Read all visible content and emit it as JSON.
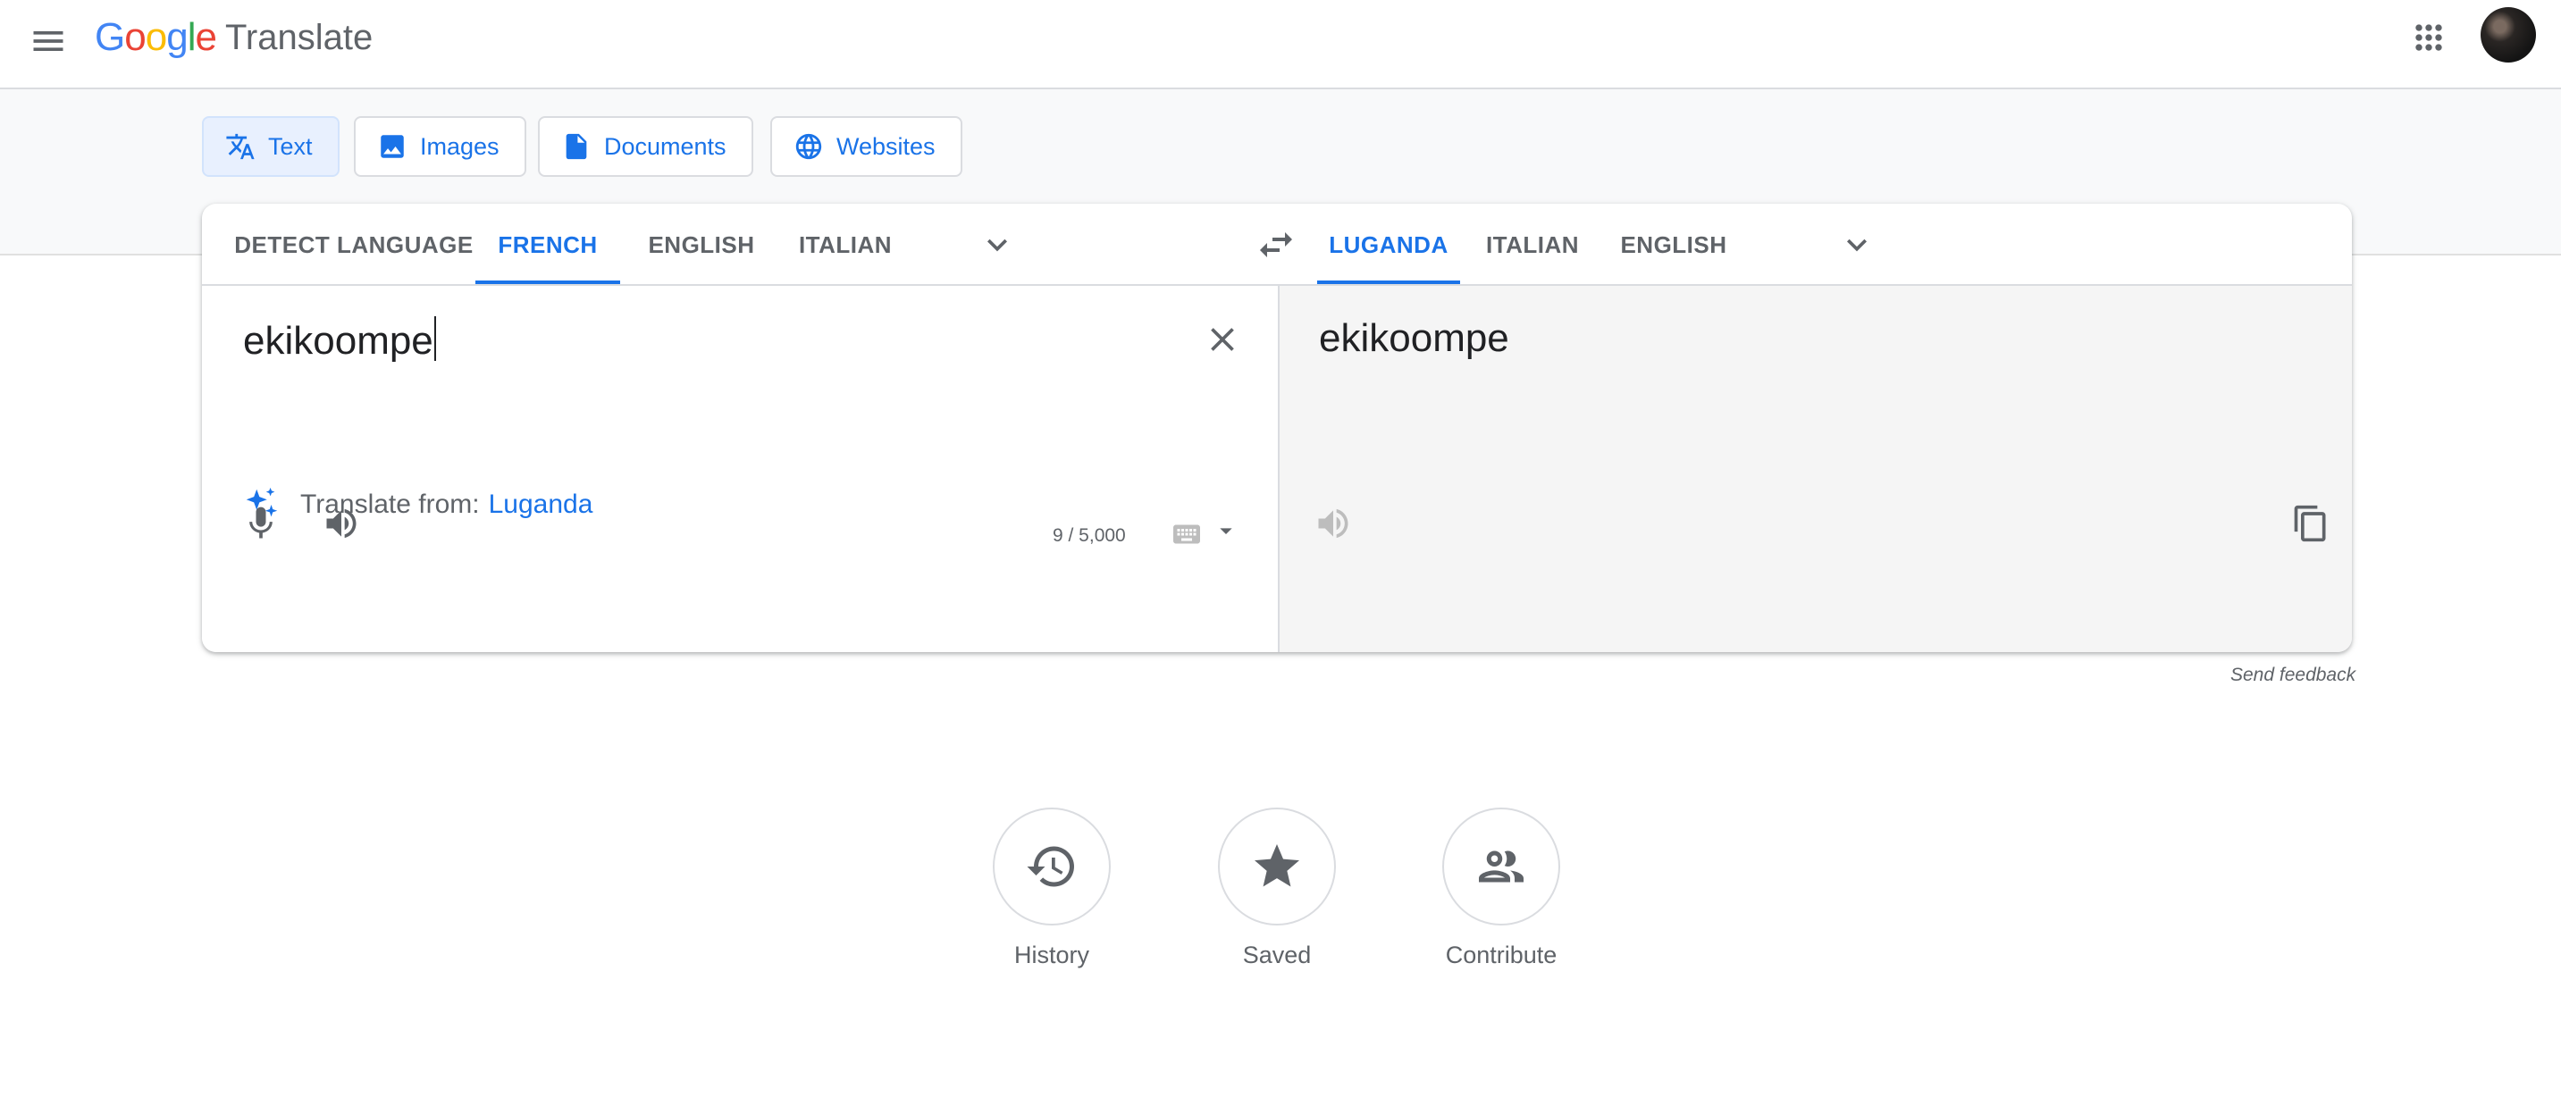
{
  "header": {
    "logo_letters": [
      "G",
      "o",
      "o",
      "g",
      "l",
      "e"
    ],
    "product": "Translate"
  },
  "modes": [
    {
      "label": "Text",
      "icon": "translate-icon",
      "active": true
    },
    {
      "label": "Images",
      "icon": "image-icon",
      "active": false
    },
    {
      "label": "Documents",
      "icon": "document-icon",
      "active": false
    },
    {
      "label": "Websites",
      "icon": "globe-icon",
      "active": false
    }
  ],
  "source_langs": [
    "DETECT LANGUAGE",
    "FRENCH",
    "ENGLISH",
    "ITALIAN"
  ],
  "source_selected": "FRENCH",
  "target_langs": [
    "LUGANDA",
    "ITALIAN",
    "ENGLISH"
  ],
  "target_selected": "LUGANDA",
  "source": {
    "text": "ekikoompe",
    "suggestion_prefix": "Translate from:",
    "suggestion_lang": "Luganda",
    "char_count": "9 / 5,000"
  },
  "target": {
    "text": "ekikoompe"
  },
  "feedback": "Send feedback",
  "bottom": [
    {
      "label": "History",
      "icon": "history-icon"
    },
    {
      "label": "Saved",
      "icon": "star-filled-icon"
    },
    {
      "label": "Contribute",
      "icon": "people-icon"
    }
  ],
  "colors": {
    "accent": "#1a73e8",
    "selected_tab_bg": "#e8f0fe",
    "target_bg": "#f5f5f5"
  }
}
